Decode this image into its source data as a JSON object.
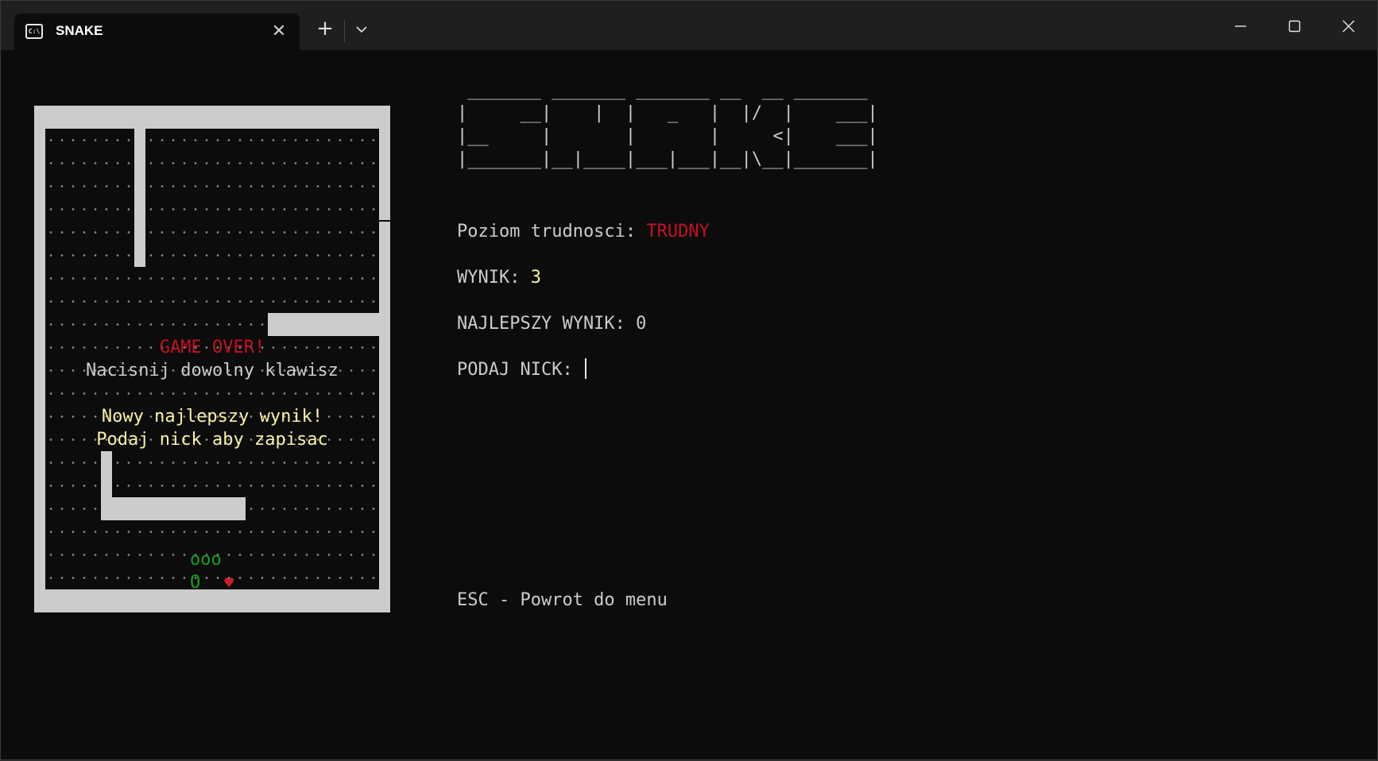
{
  "window": {
    "tab_title": "SNAKE",
    "tab_icon_text": "C:\\",
    "close_tab_glyph": "✕",
    "new_tab_glyph": "+"
  },
  "colors": {
    "background": "#0c0c0c",
    "wall": "#cccccc",
    "text": "#cccccc",
    "red": "#c50f1f",
    "yellow": "#f9f1a5",
    "snake": "#16a016"
  },
  "board": {
    "game_over": "GAME OVER!",
    "press_key": "Nacisnij dowolny klawisz",
    "new_best_line1": "Nowy najlepszy wynik!",
    "new_best_line2": "Podaj nick aby zapisac",
    "snake_body": "ooo",
    "snake_head": "O",
    "food": "♥"
  },
  "logo_ascii": " _______ _______ _______ __  __ _______\n|     __|    |  |   _   |  |/  |    ___|\n|__     |       |       |     <|    ___|\n|_______|__|____|___|___|__|\\__|_______|",
  "info": {
    "difficulty_label": "Poziom trudnosci: ",
    "difficulty_value": "TRUDNY",
    "score_label": "WYNIK: ",
    "score_value": "3",
    "best_label": "NAJLEPSZY WYNIK: ",
    "best_value": "0",
    "nick_label": "PODAJ NICK: ",
    "nick_value": "",
    "esc_hint": "ESC - Powrot do menu"
  }
}
